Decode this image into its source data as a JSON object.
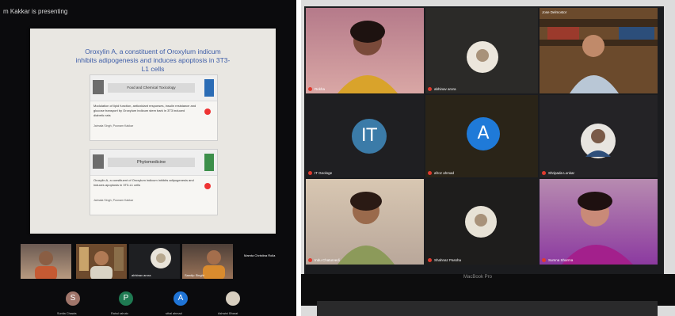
{
  "banner": "m Kakkar is presenting",
  "slide": {
    "title": "Oroxylin A, a constituent of Oroxylum indicum inhibits adipogenesis and induces apoptosis in 3T3-L1 cells",
    "card1": {
      "journal": "Food and Chemical Toxicology",
      "abstract": "Modulation of lipid function, antioxidant responses, insulin resistance and glucose transport by Oroxylum indicum stem bark in 3T3 induced diabetic rats",
      "authors": "Jaimala Singh, Poonam Kakkar"
    },
    "card2": {
      "journal": "Phytomedicine",
      "abstract": "Oroxylin A, a constituent of Oroxylum indicum inhibits adipogenesis and induces apoptosis in 3T3-L1 cells",
      "authors": "Jaimala Singh, Poonam Kakkar"
    }
  },
  "left_strip": [
    {
      "name": ""
    },
    {
      "name": ""
    },
    {
      "name": "abhinav arora"
    },
    {
      "name": "Sandip Singhi"
    },
    {
      "name": "Mamta Christina Rolla"
    }
  ],
  "left_avatars": [
    {
      "letter": "S",
      "name": "Sunita Chawla",
      "color": "#a0756a"
    },
    {
      "letter": "P",
      "name": "Rahul rahuto",
      "color": "#1f7a52"
    },
    {
      "letter": "A",
      "name": "sthal ahmad",
      "color": "#1f74d6"
    },
    {
      "letter": "",
      "name": "Ashwini Bharat",
      "color": "#d8cfc0"
    }
  ],
  "right_tiles": [
    {
      "name": "Rekha"
    },
    {
      "name": "abhinav arora"
    },
    {
      "name": "Jose Delmostor"
    },
    {
      "name": "IT Geologe",
      "letter": "IT",
      "color": "#3b7ba8"
    },
    {
      "name": "afroz ahmad",
      "letter": "A",
      "color": "#1f7ad8"
    },
    {
      "name": "Shripada Lonkar"
    },
    {
      "name": "Indu Chaturvedi"
    },
    {
      "name": "Shahnaz Passha"
    },
    {
      "name": "Sumna Sharma"
    }
  ],
  "macbook_label": "MacBook Pro"
}
